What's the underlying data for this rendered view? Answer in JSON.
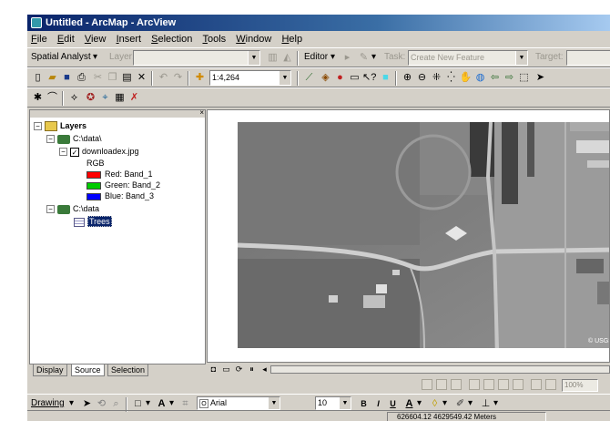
{
  "window": {
    "title": "Untitled - ArcMap - ArcView"
  },
  "menu": [
    "File",
    "Edit",
    "View",
    "Insert",
    "Selection",
    "Tools",
    "Window",
    "Help"
  ],
  "toolbar_spatial": {
    "spatial_analyst": "Spatial Analyst",
    "layer_label": "Layer:",
    "editor": "Editor",
    "task_label": "Task:",
    "task_value": "Create New Feature",
    "target_label": "Target:"
  },
  "toolbar_standard": {
    "scale": "1:4,264"
  },
  "toc": {
    "root": "Layers",
    "group1": "C:\\data\\",
    "layer1": "downloadex.jpg",
    "rgb": "RGB",
    "red": "Red:   Band_1",
    "green": "Green: Band_2",
    "blue": "Blue:  Band_3",
    "group2": "C:\\data",
    "layer2": "Trees",
    "swatch_colors": {
      "red": "#ff0000",
      "green": "#00cc00",
      "blue": "#0000ff"
    }
  },
  "tabs": {
    "display": "Display",
    "source": "Source",
    "selection": "Selection"
  },
  "bottom_toolbar": {
    "zoom": "100%"
  },
  "drawing": {
    "drawing_label": "Drawing",
    "font": "Arial",
    "size": "10",
    "bold": "B",
    "italic": "I",
    "underline": "U"
  },
  "status": {
    "coordinates": "626604.12  4629549.42 Meters"
  },
  "map": {
    "copyright": "© USGS"
  }
}
